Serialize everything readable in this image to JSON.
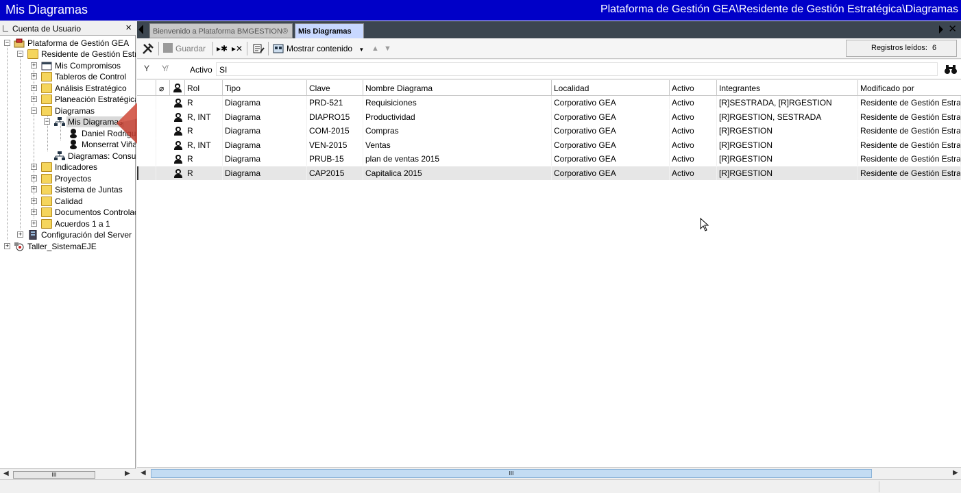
{
  "window": {
    "title": "Mis Diagramas",
    "path": "Plataforma de Gestión GEA\\Residente de Gestión Estratégica\\Diagramas"
  },
  "left_panel": {
    "title": "Cuenta de Usuario",
    "close": "×",
    "scroll_thumb": "III",
    "tree": [
      {
        "label": "Plataforma de Gestión GEA",
        "exp": "−"
      },
      {
        "label": "Residente de Gestión Estrat",
        "exp": "−"
      },
      {
        "label": "Mis Compromisos",
        "exp": "+"
      },
      {
        "label": "Tableros de Control",
        "exp": "+"
      },
      {
        "label": "Análisis Estratégico",
        "exp": "+"
      },
      {
        "label": "Planeación Estratégica",
        "exp": "+"
      },
      {
        "label": "Diagramas",
        "exp": "−"
      },
      {
        "label": "Mis Diagramas",
        "exp": "−"
      },
      {
        "label": "Daniel Rodrigue",
        "exp": ""
      },
      {
        "label": "Monserrat Viñas",
        "exp": ""
      },
      {
        "label": "Diagramas: Consult",
        "exp": ""
      },
      {
        "label": "Indicadores",
        "exp": "+"
      },
      {
        "label": "Proyectos",
        "exp": "+"
      },
      {
        "label": "Sistema de Juntas",
        "exp": "+"
      },
      {
        "label": "Calidad",
        "exp": "+"
      },
      {
        "label": "Documentos Controlado",
        "exp": "+"
      },
      {
        "label": "Acuerdos 1 a 1",
        "exp": "+"
      },
      {
        "label": "Configuración del Server",
        "exp": "+"
      },
      {
        "label": "Taller_SistemaEJE",
        "exp": "+"
      }
    ]
  },
  "tabs": [
    {
      "label": "Bienvenido a Plataforma BMGESTION®"
    },
    {
      "label": "Mis Diagramas"
    }
  ],
  "toolbar": {
    "guardar": "Guardar",
    "mostrar": "Mostrar contenido",
    "registros_label": "Registros leídos:",
    "registros_count": "6"
  },
  "filter": {
    "field": "Activo",
    "value": "SI"
  },
  "grid": {
    "columns": [
      "Rol",
      "Tipo",
      "Clave",
      "Nombre Diagrama",
      "Localidad",
      "Activo",
      "Integrantes",
      "Modificado por"
    ],
    "rows": [
      [
        "R",
        "Diagrama",
        "PRD-521",
        "Requisiciones",
        "Corporativo GEA",
        "Activo",
        "[R]SESTRADA, [R]RGESTION",
        "Residente de Gestión Estratég"
      ],
      [
        "R, INT",
        "Diagrama",
        "DIAPRO15",
        "Productividad",
        "Corporativo GEA",
        "Activo",
        "[R]RGESTION, SESTRADA",
        "Residente de Gestión Estratég"
      ],
      [
        "R",
        "Diagrama",
        "COM-2015",
        "Compras",
        "Corporativo GEA",
        "Activo",
        "[R]RGESTION",
        "Residente de Gestión Estratég"
      ],
      [
        "R, INT",
        "Diagrama",
        "VEN-2015",
        "Ventas",
        "Corporativo GEA",
        "Activo",
        "[R]RGESTION",
        "Residente de Gestión Estratég"
      ],
      [
        "R",
        "Diagrama",
        "PRUB-15",
        "plan de ventas 2015",
        "Corporativo GEA",
        "Activo",
        "[R]RGESTION",
        "Residente de Gestión Estratég"
      ],
      [
        "R",
        "Diagrama",
        "CAP2015",
        "Capitalica 2015",
        "Corporativo GEA",
        "Activo",
        "[R]RGESTION",
        "Residente de Gestión Estratég"
      ]
    ]
  },
  "hscroll": {
    "thumb": "III"
  },
  "colors": {
    "titlebar": "#0000c8",
    "tabs_bg": "#3c4650",
    "active_tab": "#c8d8ff",
    "arrow": "#c0392b"
  }
}
